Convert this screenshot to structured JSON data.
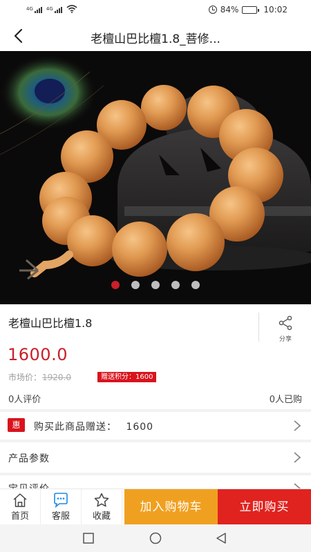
{
  "status_bar": {
    "signal_1_tag": "4G",
    "signal_2_tag": "4G",
    "battery_percent": "84%",
    "battery_level": 0.84,
    "time": "10:02"
  },
  "header": {
    "title": "老檀山巴比檀1.8_菩修..."
  },
  "gallery": {
    "image_count": 5,
    "active_index": 0
  },
  "product": {
    "name": "老檀山巴比檀1.8",
    "share_label": "分享",
    "price": "1600.0",
    "market_price_label": "市场价：",
    "market_price": "1920.0",
    "points_badge": "赠送积分：1600",
    "reviews_count": "0人评价",
    "sold_count": "0人已购"
  },
  "gift_row": {
    "badge": "惠",
    "text": "购买此商品赠送：",
    "value": "1600"
  },
  "params_row": {
    "label": "产品参数"
  },
  "review_row": {
    "label": "宝贝评价"
  },
  "bottom_bar": {
    "home_label": "首页",
    "service_label": "客服",
    "favorite_label": "收藏",
    "add_cart_label": "加入购物车",
    "buy_now_label": "立即购买"
  },
  "colors": {
    "accent_red": "#c9202a",
    "cart_orange": "#f0a020",
    "buy_red": "#e0231f",
    "service_blue": "#1e88e5"
  }
}
